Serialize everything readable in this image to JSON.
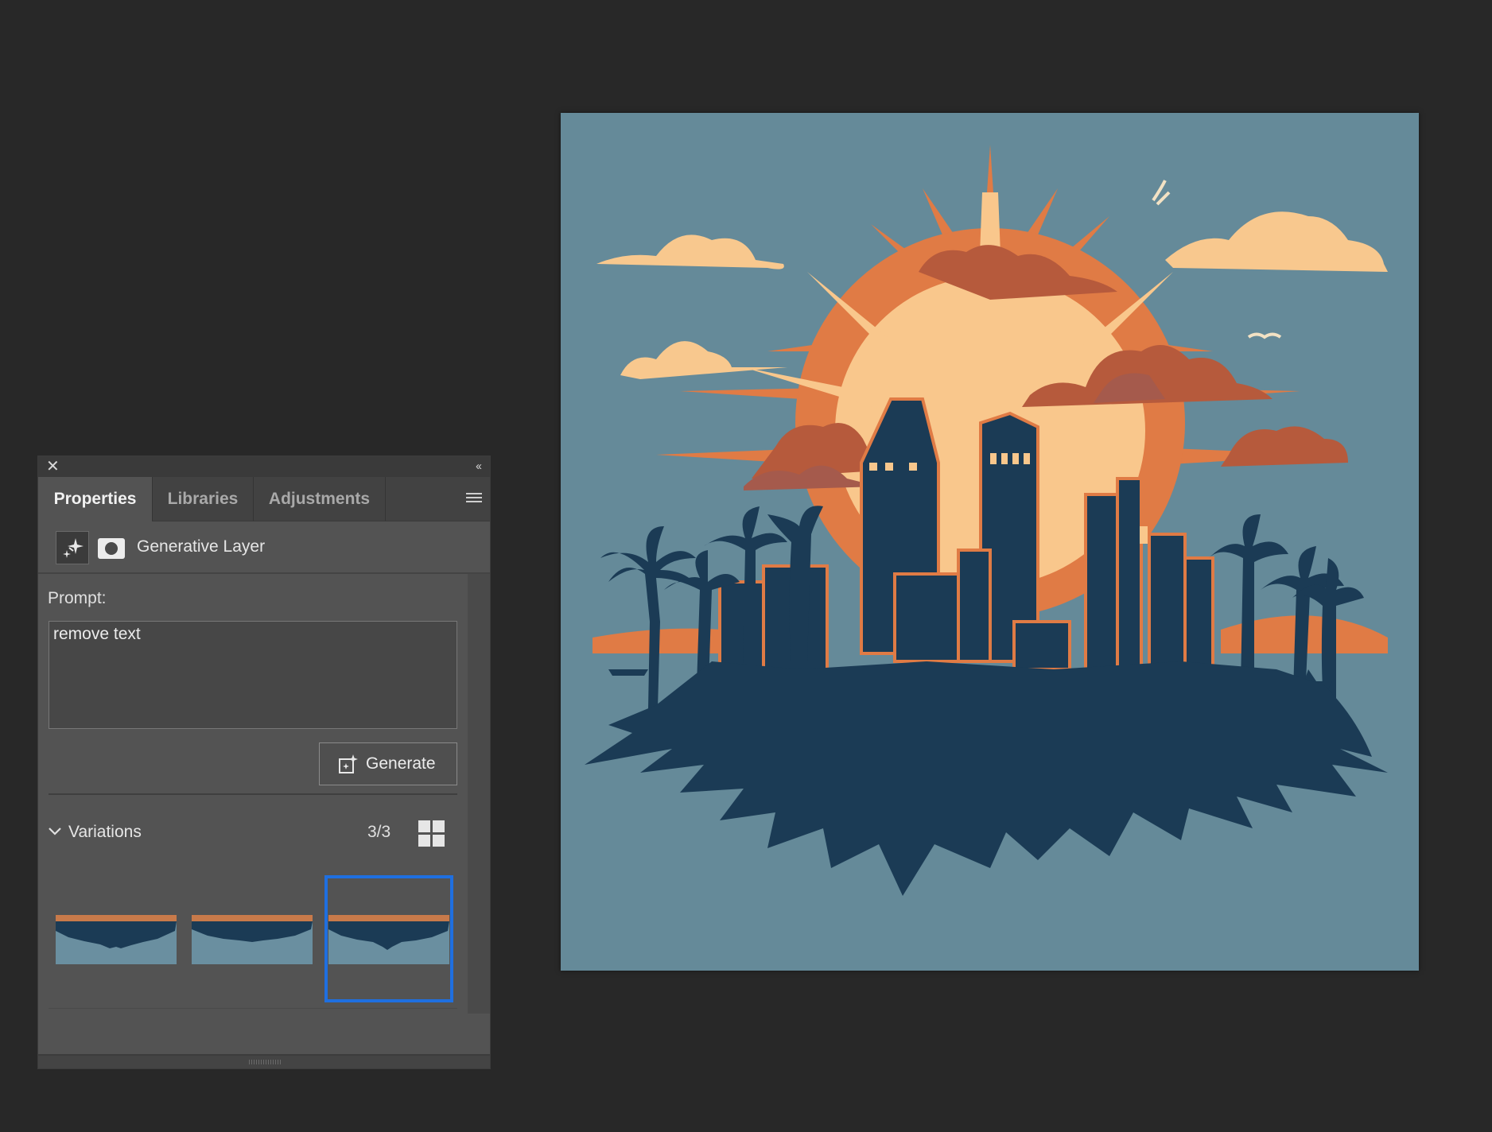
{
  "panel": {
    "close_icon": "close-icon",
    "collapse_icon": "double-chevron-left-icon",
    "tabs": [
      {
        "label": "Properties",
        "active": true
      },
      {
        "label": "Libraries",
        "active": false
      },
      {
        "label": "Adjustments",
        "active": false
      }
    ],
    "menu_icon": "hamburger-menu-icon",
    "layer": {
      "type_icon": "sparkle-icon",
      "mask_icon": "mask-icon",
      "name": "Generative Layer"
    },
    "prompt": {
      "label": "Prompt:",
      "value": "remove text"
    },
    "generate_button": {
      "label": "Generate",
      "icon": "generate-sparkle-icon"
    },
    "variations": {
      "label": "Variations",
      "count": "3/3",
      "selected_index": 2,
      "toggle_icon": "chevron-down-icon",
      "view_icon": "grid-view-icon"
    }
  },
  "canvas": {
    "description_colors": {
      "sky": "#658a99",
      "sun_light": "#f9c78c",
      "sun_orange": "#e07b45",
      "cloud_light": "#f8c88e",
      "cloud_dark": "#b65a3c",
      "silhouette": "#1b3b55"
    }
  },
  "colors": {
    "app_bg": "#282828",
    "panel_bg": "#535353",
    "selection": "#1f6fe0"
  }
}
